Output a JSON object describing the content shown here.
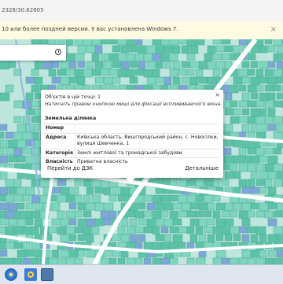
{
  "browser": {
    "url_fragment": "2328/30.62605"
  },
  "infobar": {
    "message": "10 или более поздней версии. У вас установлена Windows 7.",
    "close_glyph": "×"
  },
  "search": {
    "value": "",
    "icon": "search-icon"
  },
  "popup": {
    "close_glyph": "×",
    "count_text": "Об'єктів в цій точці: 1",
    "hint_text": "Натисніть правою кнопкою миші для фіксації всплививаючого вікна.",
    "section_title": "Земельна ділянка",
    "rows": [
      {
        "key": "Номер",
        "value": ""
      },
      {
        "key": "Адреса",
        "value": "Київська область, Вишгородський район, с. Новосілки, вулиця Шевченка, 1"
      },
      {
        "key": "Категорія",
        "value": "Землі житлової та громадської забудови"
      },
      {
        "key": "Власність",
        "value": "Приватна власність"
      }
    ],
    "link_dzk": "Перейти до ДЗК",
    "link_details": "Детальніше"
  },
  "taskbar": {
    "items": [
      "start-button-icon",
      "internet-explorer-icon",
      "app-window-icon"
    ]
  },
  "colors": {
    "parcel_fill": "#7fd6c0",
    "parcel_dark": "#5cc3a9",
    "parcel_blue": "#7ea6d9",
    "road": "#ffffff",
    "road_blue": "#8fb6e6"
  }
}
